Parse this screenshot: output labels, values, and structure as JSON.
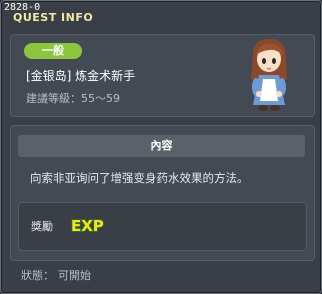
{
  "window": {
    "quest_id": "2828-0",
    "title": "QUEST INFO"
  },
  "quest": {
    "category": "一般",
    "name": "[金银岛] 炼金术新手",
    "level_requirement": "建議等級：55～59"
  },
  "content": {
    "header": "內容",
    "description": "向索非亚询问了增强变身药水效果的方法。"
  },
  "reward": {
    "label": "獎勵",
    "exp_icon_text": "EXP"
  },
  "status": {
    "label": "狀態：",
    "value": "可開始"
  },
  "colors": {
    "badge": "#8cc63f",
    "title_text": "#f3e9a6",
    "exp_yellow": "#f5e21a",
    "exp_outline": "#2f7a1f"
  }
}
